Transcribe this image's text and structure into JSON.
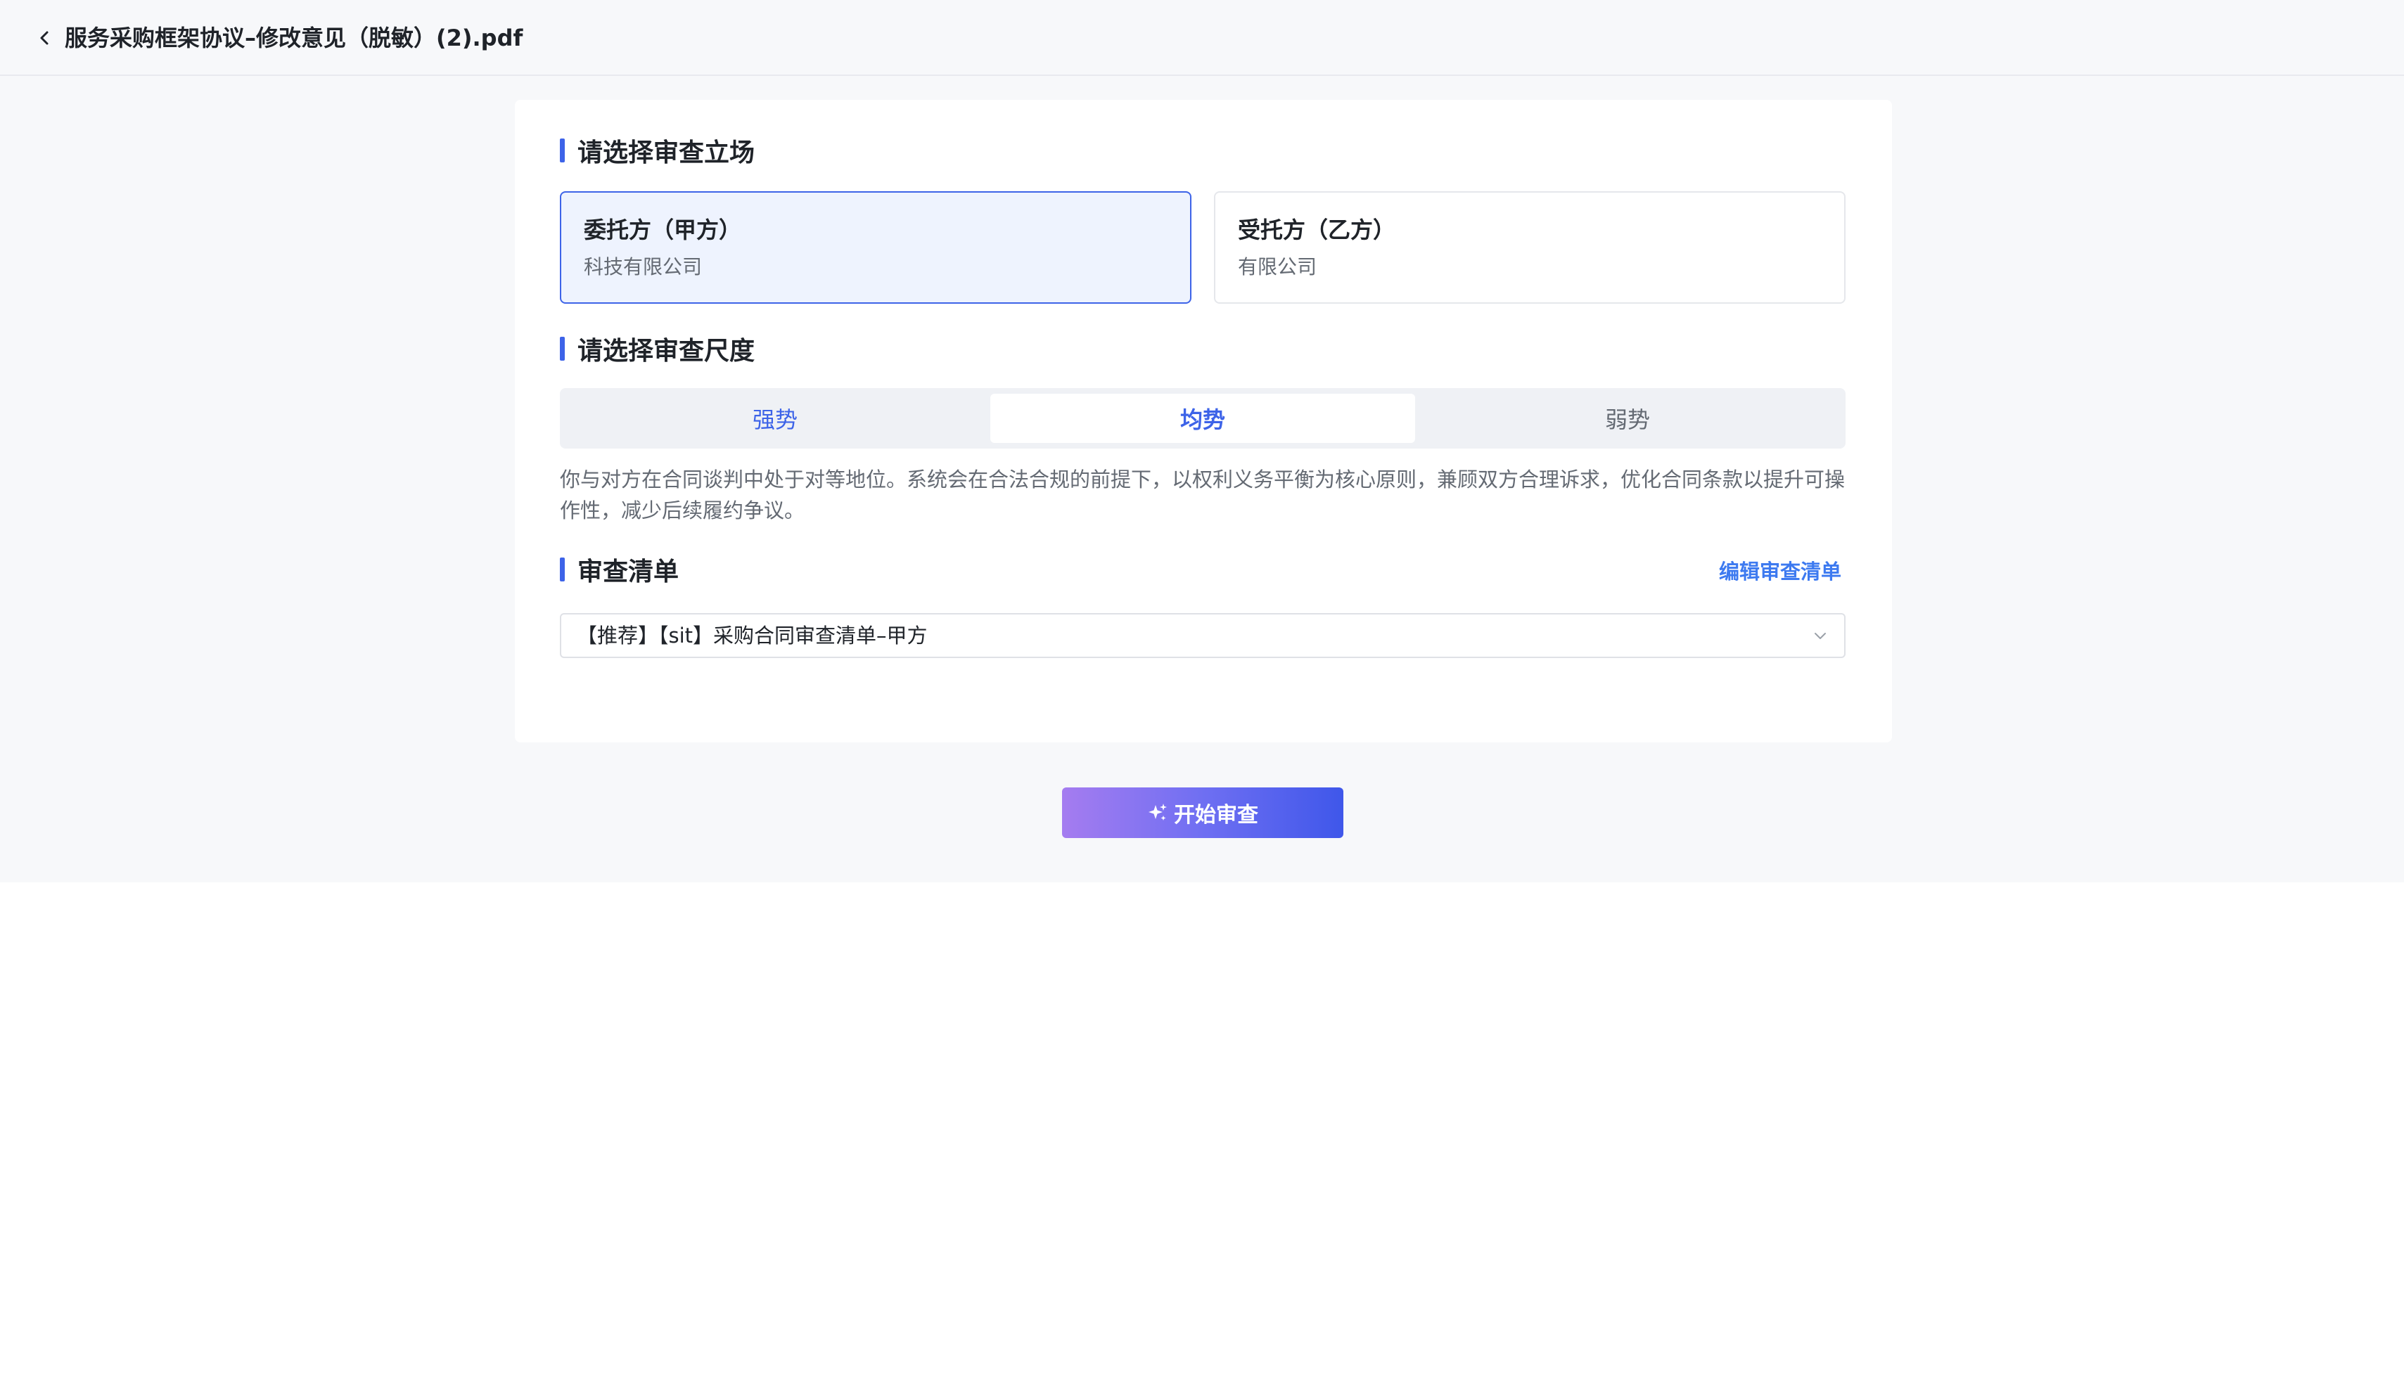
{
  "header": {
    "title": "服务采购框架协议–修改意见（脱敏）(2).pdf"
  },
  "stance": {
    "title": "请选择审查立场",
    "options": [
      {
        "name": "委托方（甲方）",
        "company": "科技有限公司",
        "selected": true
      },
      {
        "name": "受托方（乙方）",
        "company": "有限公司",
        "selected": false
      }
    ]
  },
  "scale": {
    "title": "请选择审查尺度",
    "options": [
      "强势",
      "均势",
      "弱势"
    ],
    "selected": "均势",
    "description": "你与对方在合同谈判中处于对等地位。系统会在合法合规的前提下，以权利义务平衡为核心原则，兼顾双方合理诉求，优化合同条款以提升可操作性，减少后续履约争议。"
  },
  "checklist": {
    "title": "审查清单",
    "edit_label": "编辑审查清单",
    "selected_value": "【推荐】【sit】采购合同审查清单–甲方"
  },
  "actions": {
    "start_label": "开始审查"
  },
  "colors": {
    "accent": "#3d63e8",
    "link": "#3d7af0",
    "selected_bg": "#eef3fe",
    "button_gradient_start": "#a57cf0",
    "button_gradient_end": "#3f57ea"
  }
}
